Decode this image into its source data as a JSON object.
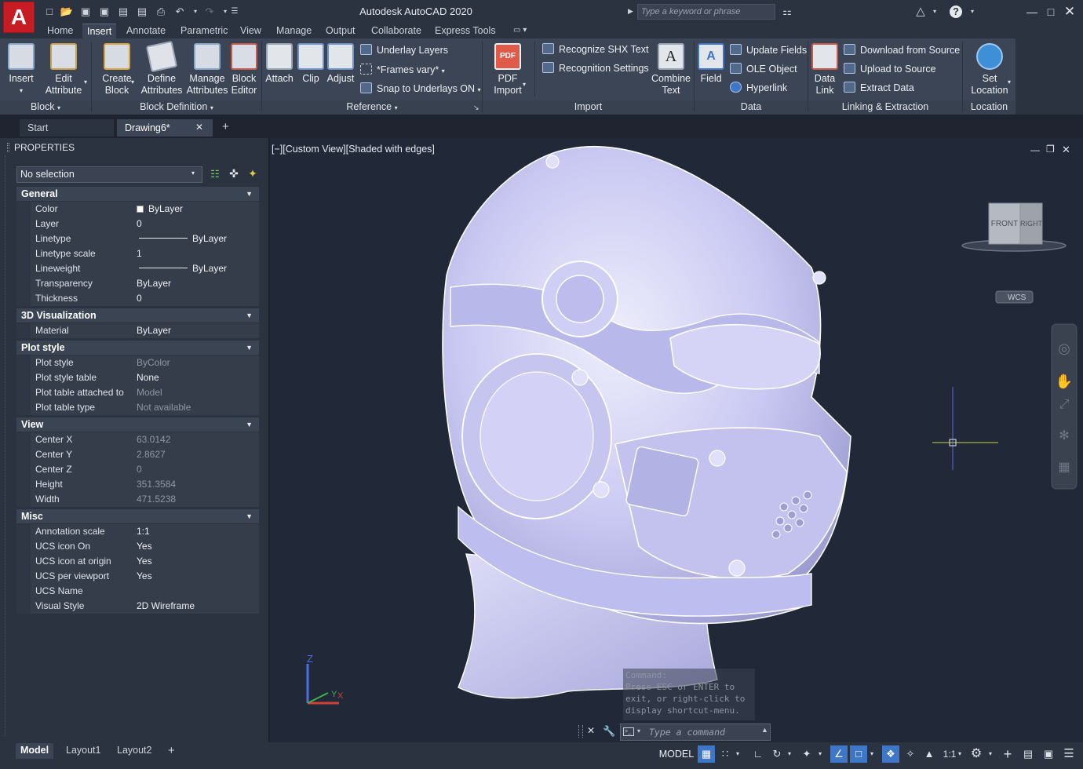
{
  "app": {
    "logo_letter": "A",
    "title": "Autodesk AutoCAD 2020",
    "search_placeholder": "Type a keyword or phrase"
  },
  "ribbon_tabs": [
    "Home",
    "Insert",
    "Annotate",
    "Parametric",
    "View",
    "Manage",
    "Output",
    "Collaborate",
    "Express Tools"
  ],
  "active_tab": "Insert",
  "panels": {
    "block": {
      "title": "Block",
      "insert": "Insert",
      "edit_attribute": [
        "Edit",
        "Attribute"
      ]
    },
    "block_definition": {
      "title": "Block Definition",
      "create_block": [
        "Create",
        "Block"
      ],
      "define_attributes": [
        "Define",
        "Attributes"
      ],
      "manage_attributes": [
        "Manage",
        "Attributes"
      ],
      "block_editor": [
        "Block",
        "Editor"
      ]
    },
    "reference": {
      "title": "Reference",
      "attach": "Attach",
      "clip": "Clip",
      "adjust": "Adjust",
      "underlay_layers": "Underlay Layers",
      "frames_vary": "*Frames vary*",
      "snap_to_underlays": "Snap to Underlays ON"
    },
    "import": {
      "title": "Import",
      "pdf_import": [
        "PDF",
        "Import"
      ],
      "recognize_shx": "Recognize SHX Text",
      "recognition_settings": "Recognition Settings",
      "combine_text": [
        "Combine",
        "Text"
      ]
    },
    "data": {
      "title": "Data",
      "field": "Field",
      "update_fields": "Update Fields",
      "ole_object": "OLE Object",
      "hyperlink": "Hyperlink"
    },
    "linking": {
      "title": "Linking & Extraction",
      "data_link": [
        "Data",
        "Link"
      ],
      "download_from_source": "Download from Source",
      "upload_to_source": "Upload to Source",
      "extract_data": "Extract  Data"
    },
    "location": {
      "title": "Location",
      "set_location": [
        "Set",
        "Location"
      ]
    }
  },
  "doc_tabs": {
    "start": "Start",
    "drawing": "Drawing6*"
  },
  "properties": {
    "title": "PROPERTIES",
    "selection": "No selection",
    "sections": [
      {
        "name": "General",
        "rows": [
          {
            "label": "Color",
            "value": "ByLayer",
            "swatch": true
          },
          {
            "label": "Layer",
            "value": "0"
          },
          {
            "label": "Linetype",
            "value": "ByLayer",
            "line": true
          },
          {
            "label": "Linetype scale",
            "value": "1"
          },
          {
            "label": "Lineweight",
            "value": "ByLayer",
            "line": true
          },
          {
            "label": "Transparency",
            "value": "ByLayer"
          },
          {
            "label": "Thickness",
            "value": "0"
          }
        ]
      },
      {
        "name": "3D Visualization",
        "rows": [
          {
            "label": "Material",
            "value": "ByLayer"
          }
        ]
      },
      {
        "name": "Plot style",
        "rows": [
          {
            "label": "Plot style",
            "value": "ByColor",
            "dim": true
          },
          {
            "label": "Plot style table",
            "value": "None"
          },
          {
            "label": "Plot table attached to",
            "value": "Model",
            "dim": true
          },
          {
            "label": "Plot table type",
            "value": "Not available",
            "dim": true
          }
        ]
      },
      {
        "name": "View",
        "rows": [
          {
            "label": "Center X",
            "value": "63.0142",
            "dim": true
          },
          {
            "label": "Center Y",
            "value": "2.8627",
            "dim": true
          },
          {
            "label": "Center Z",
            "value": "0",
            "dim": true
          },
          {
            "label": "Height",
            "value": "351.3584",
            "dim": true
          },
          {
            "label": "Width",
            "value": "471.5238",
            "dim": true
          }
        ]
      },
      {
        "name": "Misc",
        "rows": [
          {
            "label": "Annotation scale",
            "value": "1:1"
          },
          {
            "label": "UCS icon On",
            "value": "Yes"
          },
          {
            "label": "UCS icon at origin",
            "value": "Yes"
          },
          {
            "label": "UCS per viewport",
            "value": "Yes"
          },
          {
            "label": "UCS Name",
            "value": ""
          },
          {
            "label": "Visual Style",
            "value": "2D Wireframe"
          }
        ]
      }
    ]
  },
  "viewport": {
    "label": "[−][Custom View][Shaded with edges]",
    "viewcube_front": "FRONT",
    "viewcube_right": "RIGHT",
    "wcs": "WCS",
    "ucs_z": "Z",
    "ucs_y": "Y",
    "ucs_x": "X"
  },
  "command": {
    "history_line1": "Command:",
    "history_line2": "Press ESC or ENTER to",
    "history_line3": "exit, or right-click to",
    "history_line4": "display shortcut-menu.",
    "placeholder": "Type a command"
  },
  "layout_tabs": [
    "Model",
    "Layout1",
    "Layout2"
  ],
  "status": {
    "model": "MODEL",
    "scale": "1:1"
  },
  "colors": {
    "accent": "#3f77c8",
    "logo_red": "#c61c23",
    "ribbon_bg": "#3c4555",
    "model_shade": "#c9c8f2"
  }
}
